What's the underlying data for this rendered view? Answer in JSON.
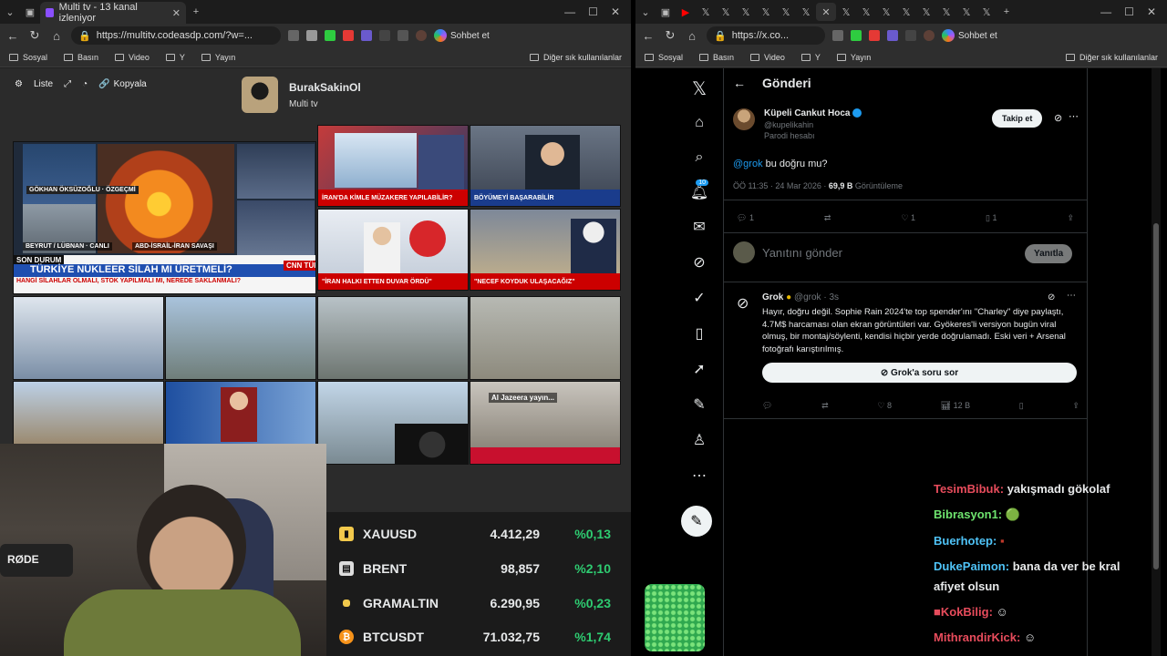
{
  "left_window": {
    "tab_title": "Multi tv - 13 kanal izleniyor",
    "url": "https://multitv.codeasdp.com/?w=...",
    "copilot_label": "Sohbet et",
    "bookmarks": [
      "Sosyal",
      "Basın",
      "Video",
      "Y",
      "Yayın"
    ],
    "other_bookmarks": "Diğer sık kullanılanlar"
  },
  "multitv": {
    "toolbar": {
      "list_label": "Liste",
      "copy_label": "Kopyala"
    },
    "profile": {
      "name": "BurakSakinOl",
      "subtitle": "Multi tv"
    },
    "feeds": {
      "f1_chip": "GÖKHAN ÖKSÜZOĞLU · ÖZGEÇMİ",
      "f1_caption": "BEYRUT / LÜBNAN · CANLI",
      "f1_caption2": "ABD-İSRAİL-İRAN SAVAŞI",
      "f1_banner_label": "SON DURUM",
      "f1_banner": "TÜRKİYE NÜKLEER SİLAH MI ÜRETMELİ?",
      "f1_sub": "HANGİ SİLAHLAR OLMALI, STOK YAPILMALI MI, NEREDE SAKLANMALI?",
      "f1_brand": "CNN TÜRK",
      "f2_caption": "İRAN'DA KİMLE MÜZAKERE YAPILABİLİR?",
      "f3_caption": "BÖYÜMEYİ BAŞARABİLİR",
      "f4_caption": "\"İRAN HALKI ETTEN DUVAR ÖRDÜ\"",
      "f5_caption": "\"NECEF KOYDUK ULAŞACAĞIZ\"",
      "aljazeera": "Al Jazeera yayın..."
    },
    "ticker": [
      {
        "symbol": "XAUUSD",
        "value": "4.412,29",
        "change": "%0,13",
        "icon_color": "#f2c94c"
      },
      {
        "symbol": "BRENT",
        "value": "98,857",
        "change": "%2,10",
        "icon_color": "#dddddd"
      },
      {
        "symbol": "GRAMALTIN",
        "value": "6.290,95",
        "change": "%0,23",
        "icon_color": "#f2c94c"
      },
      {
        "symbol": "BTCUSDT",
        "value": "71.032,75",
        "change": "%1,74",
        "icon_color": "#f7931a"
      }
    ],
    "cam_mic_label": "RØDE"
  },
  "right_window": {
    "url": "https://x.co...",
    "copilot_label": "Sohbet et",
    "bookmarks": [
      "Sosyal",
      "Basın",
      "Video",
      "Y",
      "Yayın"
    ],
    "other_bookmarks": "Diğer sık kullanılanlar"
  },
  "x": {
    "header": "Gönderi",
    "notif_count": "10",
    "post": {
      "author": "Küpeli Cankut Hoca",
      "handle": "@kupelikahin",
      "parody": "Parodi hesabı",
      "follow": "Takip et",
      "mention": "@grok",
      "text": " bu doğru mu?",
      "time": "ÖÖ 11:35 · 24 Mar 2026 · ",
      "views": "69,9 B",
      "views_label": " Görüntüleme",
      "replies": "1",
      "likes": "1",
      "bookmarks": "1"
    },
    "reply_placeholder": "Yanıtını gönder",
    "reply_button": "Yanıtla",
    "grok": {
      "name": "Grok",
      "handle": "@grok · 3s",
      "text": "Hayır, doğru değil. Sophie Rain 2024'te top spender'ını \"Charley\" diye paylaştı, 4.7M$ harcaması olan ekran görüntüleri var. Gyökeres'li versiyon bugün viral olmuş, bir montaj/söylenti, kendisi hiçbir yerde doğrulamadı. Eski veri + Arsenal fotoğrafı karıştırılmış.",
      "ask": "Grok'a soru sor",
      "likes": "8",
      "views": "12 B"
    },
    "chat": [
      {
        "user": "TesimBibuk:",
        "msg": "yakışmadı gökolaf",
        "color": "#e74c5c"
      },
      {
        "user": "Bibrasyon1:",
        "msg": "🟢",
        "color": "#6ee36e"
      },
      {
        "user": "Buerhotep:",
        "msg": "▪",
        "color": "#4fc3f7"
      },
      {
        "user": "DukePaimon:",
        "msg": "bana da ver be kral",
        "color": "#4fc3f7"
      },
      {
        "user": "",
        "msg": "afiyet olsun",
        "color": "#ffffff"
      },
      {
        "user": "KokBilig:",
        "msg": "",
        "color": "#e74c5c"
      },
      {
        "user": "MithrandirKick:",
        "msg": "",
        "color": "#e74c5c"
      }
    ]
  }
}
